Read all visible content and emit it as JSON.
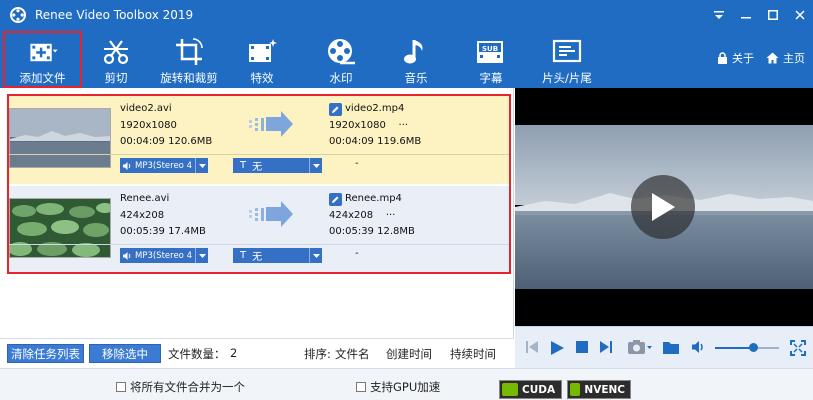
{
  "window": {
    "title": "Renee Video Toolbox 2019"
  },
  "toolbar": {
    "items": [
      {
        "label": "添加文件",
        "icon": "film-add-icon"
      },
      {
        "label": "剪切",
        "icon": "scissors-icon"
      },
      {
        "label": "旋转和裁剪",
        "icon": "crop-rotate-icon"
      },
      {
        "label": "特效",
        "icon": "film-effects-icon"
      },
      {
        "label": "水印",
        "icon": "film-reel-icon"
      },
      {
        "label": "音乐",
        "icon": "music-note-icon"
      },
      {
        "label": "字幕",
        "icon": "subtitle-icon"
      },
      {
        "label": "片头/片尾",
        "icon": "intro-outro-icon"
      }
    ],
    "about_label": "关于",
    "home_label": "主页"
  },
  "files": [
    {
      "src_name": "video2.avi",
      "src_resolution": "1920x1080",
      "src_info": "00:04:09  120.6MB",
      "dst_name": "video2.mp4",
      "dst_resolution": "1920x1080",
      "dst_more": "···",
      "dst_info": "00:04:09  119.6MB",
      "audio": "MP3(Stereo 4",
      "subtitle_prefix": "T",
      "subtitle": "无",
      "dash": "-"
    },
    {
      "src_name": "Renee.avi",
      "src_resolution": "424x208",
      "src_info": "00:05:39  17.4MB",
      "dst_name": "Renee.mp4",
      "dst_resolution": "424x208",
      "dst_more": "···",
      "dst_info": "00:05:39  12.8MB",
      "audio": "MP3(Stereo 4",
      "subtitle_prefix": "T",
      "subtitle": "无",
      "dash": "-"
    }
  ],
  "actions": {
    "clear_label": "清除任务列表",
    "remove_label": "移除选中",
    "count_label": "文件数量：",
    "count_value": "2",
    "sort_label": "排序:",
    "sort_name": "文件名",
    "sort_created": "创建时间",
    "sort_duration": "持续时间"
  },
  "bottom": {
    "merge_label": "将所有文件合并为一个",
    "gpu_label": "支持GPU加速",
    "cuda_label": "CUDA",
    "nvenc_label": "NVENC"
  },
  "player": {
    "volume": 0.6
  },
  "colors": {
    "brand": "#1f6cc2",
    "row_selected": "#fdf2c2",
    "row_normal": "#e9eef7",
    "highlight": "#e8232b",
    "nvidia": "#76b900"
  }
}
